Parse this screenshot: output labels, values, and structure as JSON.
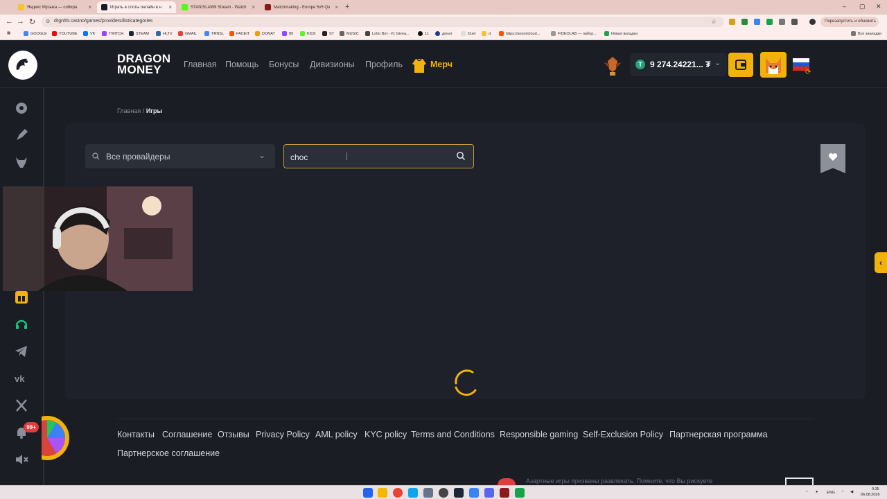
{
  "browser": {
    "tabs": [
      {
        "label": "Яндекс Музыка — собира",
        "active": false
      },
      {
        "label": "Играть в слоты онлайн в н",
        "active": true
      },
      {
        "label": "STANISLAW9 Stream - Watch",
        "active": false
      },
      {
        "label": "Matchmaking - Europe 5v5 Qu",
        "active": false
      }
    ],
    "url": "drgn55.casino/games/providers/list/categories",
    "restart_label": "Перезапустить и обновить",
    "bookmarks": [
      "GOOGLE",
      "YOUTUBE",
      "VK",
      "TWITCH",
      "STEAM",
      "HLTV",
      "GMAIL",
      "TRNSL",
      "FACEIT",
      "DONAT",
      "89",
      "KICK",
      "ST",
      "MUSIC",
      "Lotto Bot - #1 Givea...",
      "11",
      "донат",
      "Duel",
      "d",
      "https://soundcloud...",
      "FIDEOLAB — лабор...",
      "Новая вкладка"
    ],
    "all_bookmarks": "Все закладки"
  },
  "site": {
    "brand_line1": "DRAGON",
    "brand_line2": "MONEY",
    "nav": [
      "Главная",
      "Помощь",
      "Бонусы",
      "Дивизионы",
      "Профиль"
    ],
    "merch_label": "Мерч",
    "balance": "9 274.24221...",
    "currency_symbol": "₮",
    "coin_symbol": "T",
    "breadcrumb": {
      "home": "Главная",
      "separator": "/",
      "current": "Игры"
    },
    "provider_select": "Все провайдеры",
    "search_value": "choc",
    "notification_badge": "99+",
    "footer_links_row1": [
      "Контакты",
      "Соглашение",
      "Отзывы",
      "Privacy Policy",
      "AML policy",
      "KYC policy",
      "Terms and Conditions",
      "Responsible gaming",
      "Self-Exclusion Policy",
      "Партнерская программа"
    ],
    "footer_links_row2": [
      "Партнерское соглашение"
    ],
    "disclaimer": "Азартные игры призваны развлекать. Помните, что Вы рискуете"
  },
  "taskbar": {
    "lang": "ENG",
    "time": "0:35",
    "date": "06.08.2026"
  },
  "colors": {
    "accent": "#f2b20c",
    "background": "#1a1d24",
    "panel": "#1e2129"
  },
  "icons": [
    "search-icon",
    "chevron-down-icon",
    "heart-icon",
    "chevron-left-icon",
    "wallet-icon",
    "trophy-icon",
    "hoodie-icon",
    "russia-flag-icon",
    "telegram-icon",
    "vk-icon",
    "x-icon",
    "bell-icon",
    "mute-icon",
    "support-icon",
    "gift-icon"
  ]
}
